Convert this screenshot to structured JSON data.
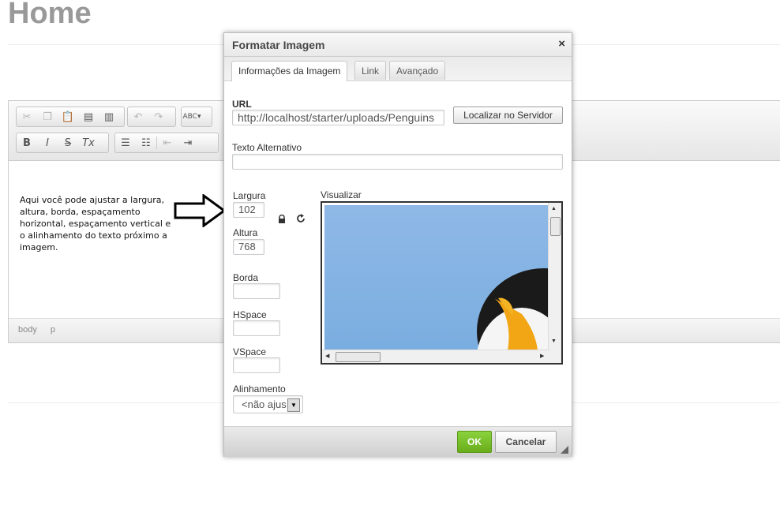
{
  "page": {
    "title": "Home"
  },
  "editor": {
    "toolbar_row1": [
      "scissors-icon",
      "copy-icon",
      "paste-icon",
      "paste-text-icon",
      "paste-word-icon",
      "undo-icon",
      "redo-icon",
      "spellcheck-icon"
    ],
    "toolbar_row2": [
      "B",
      "I",
      "S",
      "Tx"
    ],
    "body_text": "Aqui você pode ajustar a largura, altura, borda, espaçamento horizontal, espaçamento vertical e o alinhamento do texto próximo a imagem.",
    "path": [
      "body",
      "p"
    ]
  },
  "dialog": {
    "title": "Formatar Imagem",
    "close": "×",
    "tabs": [
      "Informações da Imagem",
      "Link",
      "Avançado"
    ],
    "url_label": "URL",
    "url_value": "http://localhost/starter/uploads/Penguins",
    "browse_button": "Localizar no Servidor",
    "alt_label": "Texto Alternativo",
    "alt_value": "",
    "width_label": "Largura",
    "width_value": "102",
    "height_label": "Altura",
    "height_value": "768",
    "border_label": "Borda",
    "hspace_label": "HSpace",
    "vspace_label": "VSpace",
    "align_label": "Alinhamento",
    "align_value": "<não ajus",
    "preview_label": "Visualizar",
    "ok": "OK",
    "cancel": "Cancelar"
  },
  "colors": {
    "ok_green": "#6aac1a",
    "title_gray": "#999999",
    "sky_blue": "#8fb8e6"
  }
}
